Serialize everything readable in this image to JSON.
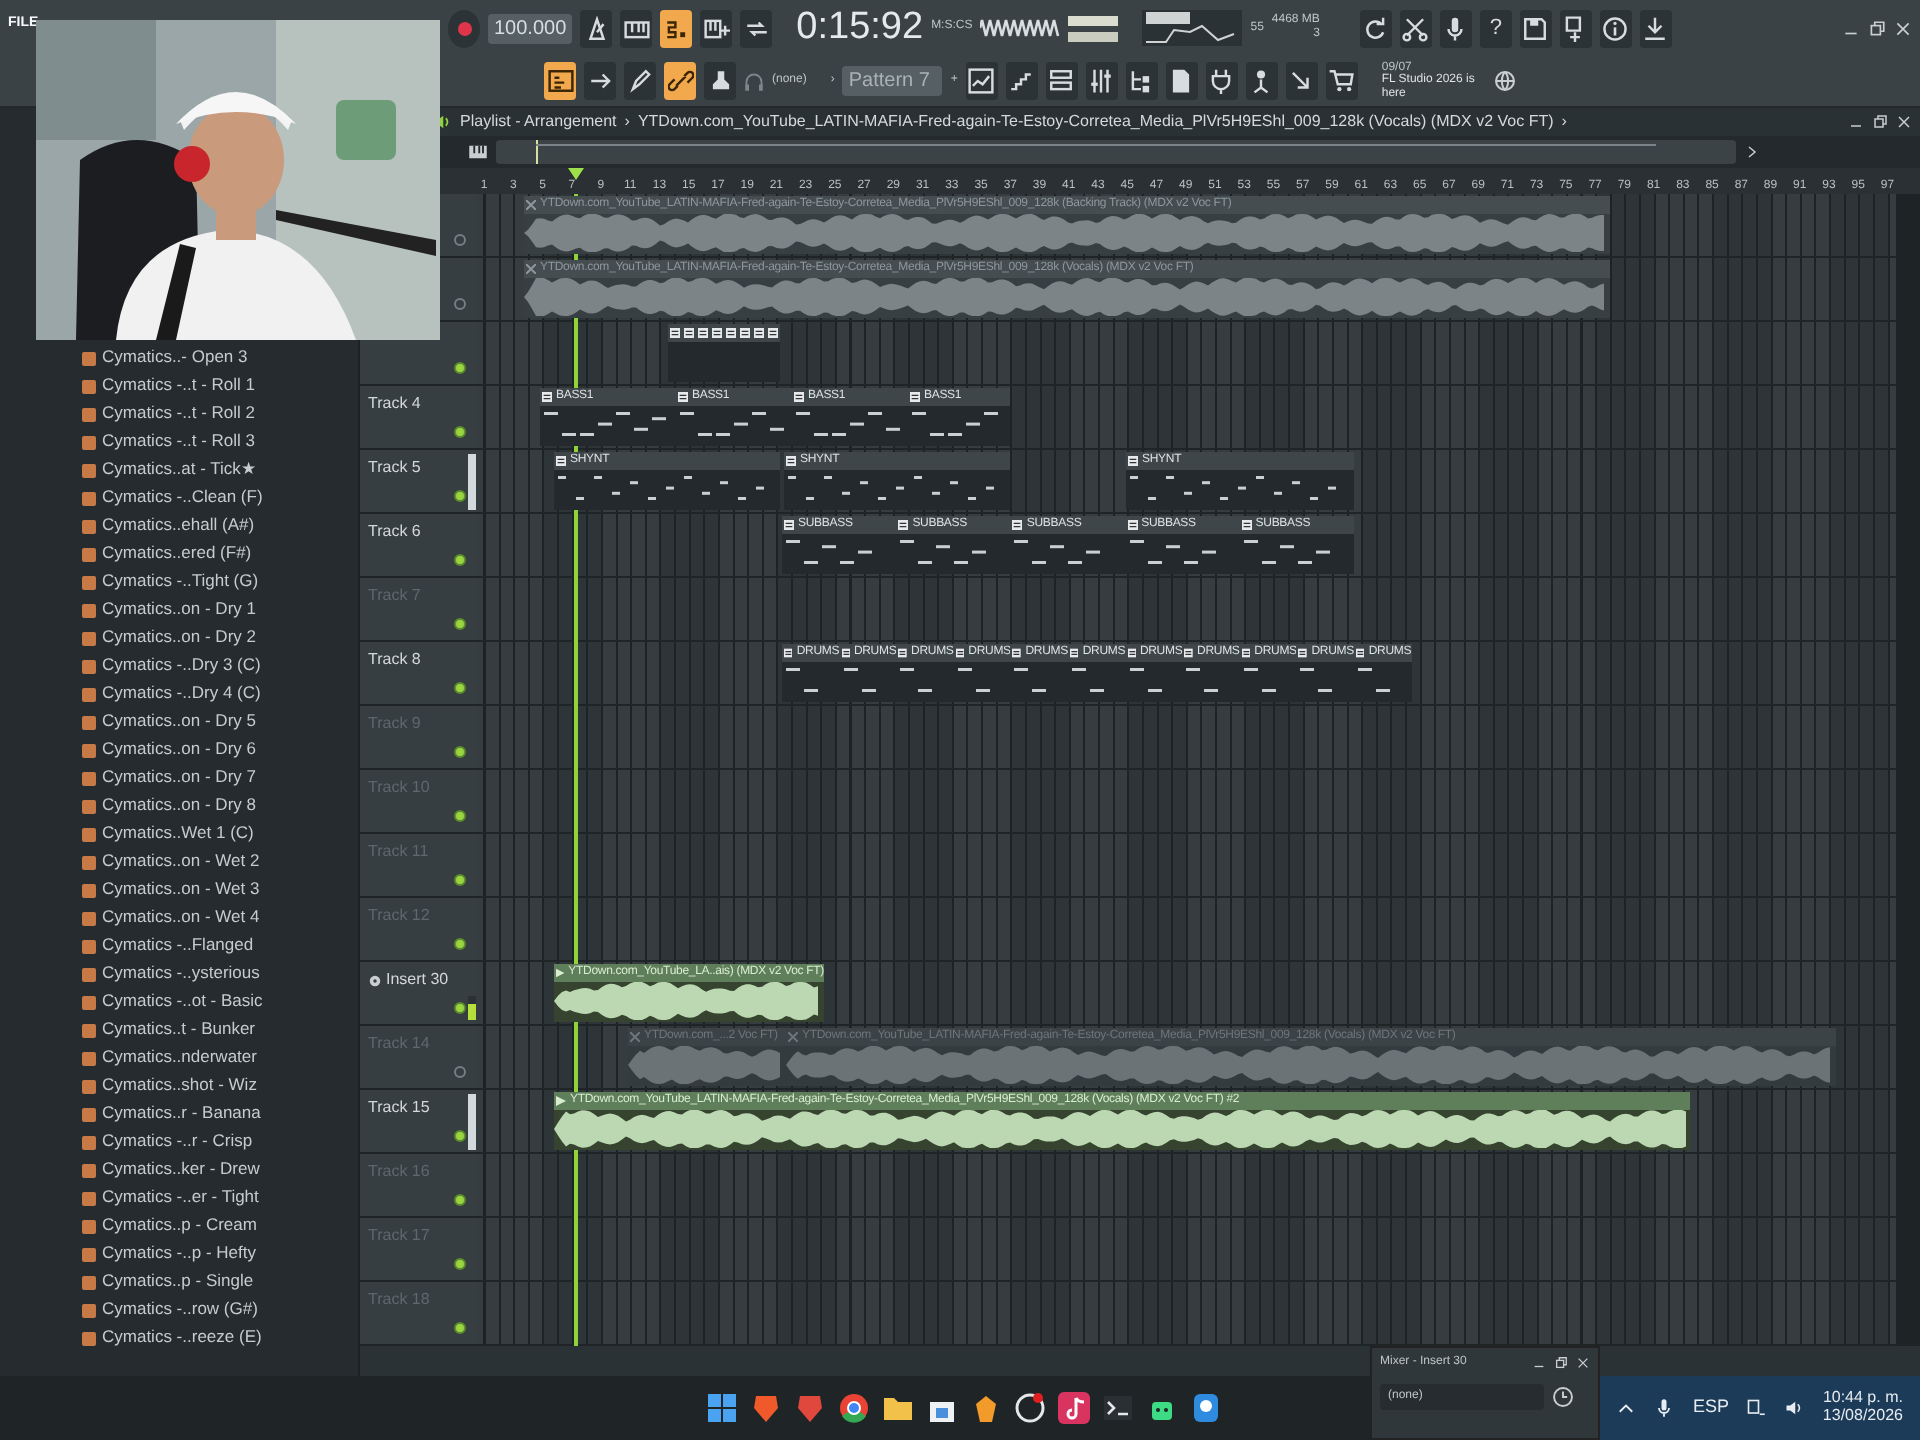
{
  "menu": {
    "first_item": "FILE"
  },
  "transport": {
    "tempo": "100.000",
    "time": "0:15:92",
    "time_unit": "M:S:CS",
    "cpu": "55",
    "memory": "4468 MB",
    "polyphony": "3",
    "help": "?"
  },
  "transport_buttons": [
    {
      "on": false
    },
    {
      "on": false
    },
    {
      "on": true
    },
    {
      "on": false
    },
    {
      "on": false
    }
  ],
  "tool_buttons": [
    {
      "on": true
    },
    {
      "on": false
    },
    {
      "on": false
    },
    {
      "on": true
    },
    {
      "on": false
    }
  ],
  "toolbar": {
    "snap": "(none)",
    "pattern_arrow": "›",
    "pattern": "Pattern 7",
    "add": "+",
    "news_date": "09/07",
    "news": "FL Studio 2026 is here"
  },
  "browser": {
    "items": [
      "Cymatics..- Open 3",
      "Cymatics -..t - Roll 1",
      "Cymatics -..t - Roll 2",
      "Cymatics -..t - Roll 3",
      "Cymatics..at - Tick★",
      "Cymatics -..Clean (F)",
      "Cymatics..ehall (A#)",
      "Cymatics..ered (F#)",
      "Cymatics -..Tight (G)",
      "Cymatics..on - Dry 1",
      "Cymatics..on - Dry 2",
      "Cymatics -..Dry 3 (C)",
      "Cymatics -..Dry 4 (C)",
      "Cymatics..on - Dry 5",
      "Cymatics..on - Dry 6",
      "Cymatics..on - Dry 7",
      "Cymatics..on - Dry 8",
      "Cymatics..Wet 1 (C)",
      "Cymatics..on - Wet 2",
      "Cymatics..on - Wet 3",
      "Cymatics..on - Wet 4",
      "Cymatics -..Flanged",
      "Cymatics -..ysterious",
      "Cymatics -..ot - Basic",
      "Cymatics..t - Bunker",
      "Cymatics..nderwater",
      "Cymatics..shot - Wiz",
      "Cymatics..r - Banana",
      "Cymatics -..r - Crisp",
      "Cymatics..ker - Drew",
      "Cymatics -..er - Tight",
      "Cymatics..p - Cream",
      "Cymatics -..p - Hefty",
      "Cymatics..p - Single",
      "Cymatics -..row (G#)",
      "Cymatics -..reeze (E)"
    ]
  },
  "playlist": {
    "title": "Playlist - Arrangement",
    "separator": "›",
    "path": "YTDown.com_YouTube_LATIN-MAFIA-Fred-again-Te-Estoy-Corretea_Media_PlVr5H9EShl_009_128k (Vocals) (MDX v2 Voc FT)",
    "path_end": "›",
    "ruler": [
      "1",
      "3",
      "5",
      "7",
      "9",
      "11",
      "13",
      "15",
      "17",
      "19",
      "21",
      "23",
      "25",
      "27",
      "29",
      "31",
      "33",
      "35",
      "37",
      "39",
      "41",
      "43",
      "45",
      "47",
      "49",
      "51",
      "53",
      "55",
      "57",
      "59",
      "61",
      "63",
      "65",
      "67",
      "69",
      "71",
      "73",
      "75",
      "77",
      "79",
      "81",
      "83",
      "85",
      "87",
      "89",
      "91",
      "93",
      "95",
      "97"
    ],
    "tracks": [
      {
        "enabled": false,
        "dimmed": false,
        "selected": false,
        "routed": false,
        "clips": [
          {
            "kind": "audio",
            "selected": false,
            "name": "YTDown.com_YouTube_LATIN-MAFIA-Fred-again-Te-Estoy-Corretea_Media_PlVr5H9EShl_009_128k (Backing Track) (MDX v2 Voc FT)"
          }
        ]
      },
      {
        "enabled": false,
        "dimmed": false,
        "selected": false,
        "routed": false,
        "clips": [
          {
            "kind": "audio",
            "selected": false,
            "name": "YTDown.com_YouTube_LATIN-MAFIA-Fred-again-Te-Estoy-Corretea_Media_PlVr5H9EShl_009_128k (Vocals) (MDX v2 Voc FT)"
          }
        ]
      },
      {
        "enabled": true,
        "dimmed": false,
        "selected": false,
        "routed": false,
        "clips": [
          {
            "kind": "pattern",
            "selected": false
          },
          {
            "kind": "pattern",
            "selected": false
          },
          {
            "kind": "pattern",
            "selected": false
          },
          {
            "kind": "pattern",
            "selected": false
          },
          {
            "kind": "pattern",
            "selected": false
          },
          {
            "kind": "pattern",
            "selected": false
          },
          {
            "kind": "pattern",
            "selected": false
          },
          {
            "kind": "pattern",
            "selected": false
          }
        ]
      },
      {
        "label": "Track 4",
        "enabled": true,
        "dimmed": false,
        "selected": false,
        "routed": false,
        "clips": [
          {
            "kind": "pattern",
            "selected": false,
            "name": "BASS1"
          },
          {
            "kind": "pattern",
            "selected": false,
            "name": "BASS1"
          },
          {
            "kind": "pattern",
            "selected": false,
            "name": "BASS1"
          },
          {
            "kind": "pattern",
            "selected": false,
            "name": "BASS1"
          }
        ]
      },
      {
        "label": "Track 5",
        "enabled": true,
        "dimmed": false,
        "selected": true,
        "routed": false,
        "clips": [
          {
            "kind": "pattern",
            "selected": false,
            "name": "SHYNT"
          },
          {
            "kind": "pattern",
            "selected": false,
            "name": "SHYNT"
          },
          {
            "kind": "pattern",
            "selected": false,
            "name": "SHYNT"
          }
        ]
      },
      {
        "label": "Track 6",
        "enabled": true,
        "dimmed": false,
        "selected": false,
        "routed": false,
        "clips": [
          {
            "kind": "pattern",
            "selected": false,
            "name": "SUBBASS"
          },
          {
            "kind": "pattern",
            "selected": false,
            "name": "SUBBASS"
          },
          {
            "kind": "pattern",
            "selected": false,
            "name": "SUBBASS"
          },
          {
            "kind": "pattern",
            "selected": false,
            "name": "SUBBASS"
          },
          {
            "kind": "pattern",
            "selected": false,
            "name": "SUBBASS"
          }
        ]
      },
      {
        "label": "Track 7",
        "enabled": true,
        "dimmed": true,
        "selected": false,
        "routed": false
      },
      {
        "label": "Track 8",
        "enabled": true,
        "dimmed": false,
        "selected": false,
        "routed": false,
        "clips": [
          {
            "kind": "pattern",
            "selected": false,
            "name": "DRUMS"
          },
          {
            "kind": "pattern",
            "selected": false,
            "name": "DRUMS"
          },
          {
            "kind": "pattern",
            "selected": false,
            "name": "DRUMS"
          },
          {
            "kind": "pattern",
            "selected": false,
            "name": "DRUMS"
          },
          {
            "kind": "pattern",
            "selected": false,
            "name": "DRUMS"
          },
          {
            "kind": "pattern",
            "selected": false,
            "name": "DRUMS"
          },
          {
            "kind": "pattern",
            "selected": false,
            "name": "DRUMS"
          },
          {
            "kind": "pattern",
            "selected": false,
            "name": "DRUMS"
          },
          {
            "kind": "pattern",
            "selected": false,
            "name": "DRUMS"
          },
          {
            "kind": "pattern",
            "selected": false,
            "name": "DRUMS"
          },
          {
            "kind": "pattern",
            "selected": false,
            "name": "DRUMS"
          }
        ]
      },
      {
        "label": "Track 9",
        "enabled": true,
        "dimmed": true,
        "selected": false,
        "routed": false
      },
      {
        "label": "Track 10",
        "enabled": true,
        "dimmed": true,
        "selected": false,
        "routed": false
      },
      {
        "label": "Track 11",
        "enabled": true,
        "dimmed": true,
        "selected": false,
        "routed": false
      },
      {
        "label": "Track 12",
        "enabled": true,
        "dimmed": true,
        "selected": false,
        "routed": false
      },
      {
        "label": "Insert 30",
        "enabled": true,
        "dimmed": false,
        "selected": false,
        "routed": true,
        "level": 0.7,
        "clips": [
          {
            "kind": "audio",
            "selected": true,
            "name": "YTDown.com_YouTube_LA..ais) (MDX v2 Voc FT)"
          }
        ]
      },
      {
        "label": "Track 14",
        "enabled": false,
        "dimmed": true,
        "selected": false,
        "routed": false,
        "clips": [
          {
            "kind": "audio",
            "selected": false,
            "name": "YTDown.com_...2 Voc FT)"
          },
          {
            "kind": "audio",
            "selected": false,
            "name": "YTDown.com_YouTube_LATIN-MAFIA-Fred-again-Te-Estoy-Corretea_Media_PlVr5H9EShl_009_128k (Vocals) (MDX v2 Voc FT)"
          }
        ]
      },
      {
        "label": "Track 15",
        "enabled": true,
        "dimmed": false,
        "selected": true,
        "routed": false,
        "clips": [
          {
            "kind": "audio",
            "selected": true,
            "name": "YTDown.com_YouTube_LATIN-MAFIA-Fred-again-Te-Estoy-Corretea_Media_PlVr5H9EShl_009_128k (Vocals) (MDX v2 Voc FT) #2"
          }
        ]
      },
      {
        "label": "Track 16",
        "enabled": true,
        "dimmed": true,
        "selected": false,
        "routed": false
      },
      {
        "label": "Track 17",
        "enabled": true,
        "dimmed": true,
        "selected": false,
        "routed": false
      },
      {
        "label": "Track 18",
        "enabled": true,
        "dimmed": true,
        "selected": false,
        "routed": false
      }
    ]
  },
  "mixer": {
    "title": "Mixer - Insert 30",
    "slot": "(none)"
  },
  "taskbar": {
    "language": "ESP",
    "time": "10:44 p. m.",
    "date": "13/08/2026"
  }
}
